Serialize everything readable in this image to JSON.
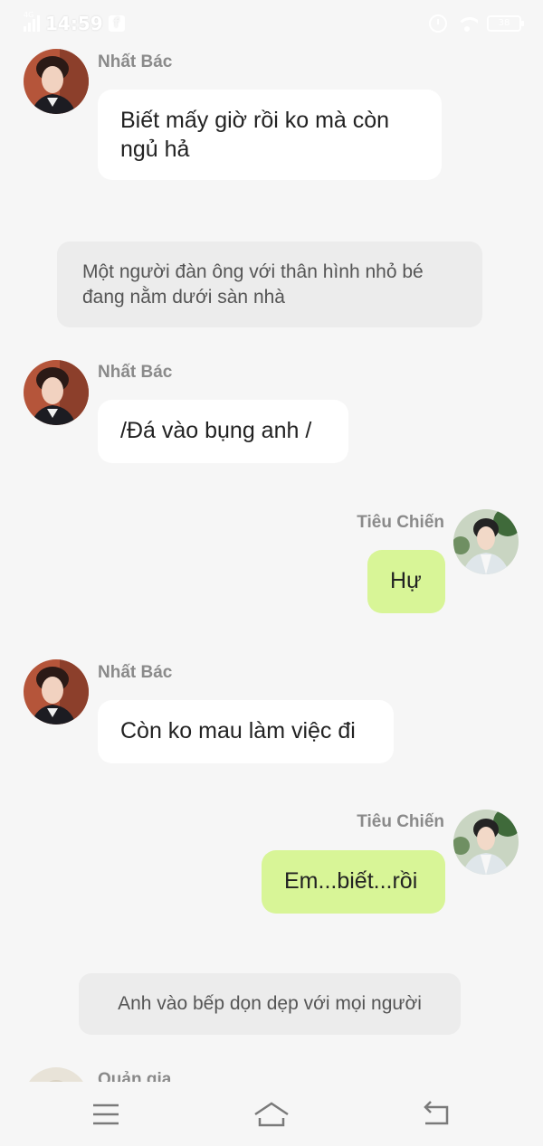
{
  "status_bar": {
    "network": "4G",
    "time": "14:59",
    "app_icon": "facebook-icon",
    "battery": "38"
  },
  "chat": {
    "messages": [
      {
        "type": "incoming",
        "sender": "Nhất Bác",
        "text": "Biết mấy giờ rồi ko mà còn ngủ hả"
      },
      {
        "type": "narration",
        "text": "Một người đàn ông với thân hình nhỏ bé đang nằm dưới sàn nhà"
      },
      {
        "type": "incoming",
        "sender": "Nhất Bác",
        "text": "/Đá vào bụng anh /"
      },
      {
        "type": "outgoing",
        "sender": "Tiêu Chiến",
        "text": "Hự"
      },
      {
        "type": "incoming",
        "sender": "Nhất Bác",
        "text": "Còn ko mau làm việc đi"
      },
      {
        "type": "outgoing",
        "sender": "Tiêu Chiến",
        "text": "Em...biết...rồi"
      },
      {
        "type": "narration",
        "text": "Anh vào bếp dọn dẹp với mọi người"
      },
      {
        "type": "incoming",
        "sender": "Quản gia",
        "text": ""
      }
    ]
  },
  "nav_bar": {
    "menu_icon": "menu-icon",
    "home_icon": "home-icon",
    "back_icon": "back-icon"
  },
  "colors": {
    "background": "#f6f6f6",
    "bubble_incoming": "#ffffff",
    "bubble_outgoing": "#d8f597",
    "narration": "#ececec",
    "sender_name": "#8a8a8a"
  }
}
